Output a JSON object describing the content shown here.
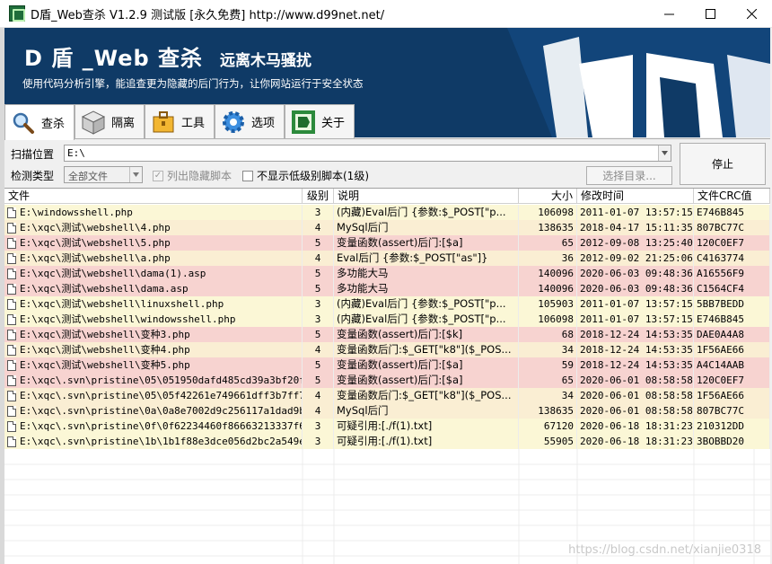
{
  "window": {
    "title": "D盾_Web查杀 V1.2.9 测试版 [永久免费] http://www.d99net.net/"
  },
  "banner": {
    "title": "D 盾 _Web 查杀",
    "subtitle": "远离木马骚扰",
    "description": "使用代码分析引擎，能追查更为隐藏的后门行为，让你网站运行于安全状态"
  },
  "tabs": [
    {
      "label": "查杀",
      "icon": "magnifier-icon",
      "active": true
    },
    {
      "label": "隔离",
      "icon": "box-icon",
      "active": false
    },
    {
      "label": "工具",
      "icon": "toolbox-icon",
      "active": false
    },
    {
      "label": "选项",
      "icon": "gear-icon",
      "active": false
    },
    {
      "label": "关于",
      "icon": "d-logo-icon",
      "active": false
    }
  ],
  "form": {
    "scan_label": "扫描位置",
    "scan_path": "E:\\",
    "type_label": "检测类型",
    "type_value": "全部文件",
    "chk_hidden": "列出隐藏脚本",
    "chk_low": "不显示低级别脚本(1级)",
    "select_dir": "选择目录...",
    "stop": "停止"
  },
  "table": {
    "headers": {
      "file": "文件",
      "level": "级别",
      "desc": "说明",
      "size": "大小",
      "time": "修改时间",
      "crc": "文件CRC值"
    },
    "rows": [
      {
        "file": "E:\\windowsshell.php",
        "level": "3",
        "desc": "(内藏)Eval后门 {参数:$_POST[\"p...",
        "size": "106098",
        "time": "2011-01-07 13:57:15",
        "crc": "E746B845",
        "color": "yellow"
      },
      {
        "file": "E:\\xqc\\测试\\webshell\\4.php",
        "level": "4",
        "desc": "MySql后门",
        "size": "138635",
        "time": "2018-04-17 15:11:35",
        "crc": "807BC77C",
        "color": "tan"
      },
      {
        "file": "E:\\xqc\\测试\\webshell\\5.php",
        "level": "5",
        "desc": "变量函数(assert)后门:[$a]",
        "size": "65",
        "time": "2012-09-08 13:25:40",
        "crc": "120C0EF7",
        "color": "red"
      },
      {
        "file": "E:\\xqc\\测试\\webshell\\a.php",
        "level": "4",
        "desc": "Eval后门 {参数:$_POST[\"as\"]}",
        "size": "36",
        "time": "2012-09-02 21:25:06",
        "crc": "C4163774",
        "color": "tan"
      },
      {
        "file": "E:\\xqc\\测试\\webshell\\dama(1).asp",
        "level": "5",
        "desc": "多功能大马",
        "size": "140096",
        "time": "2020-06-03 09:48:36",
        "crc": "A16556F9",
        "color": "red"
      },
      {
        "file": "E:\\xqc\\测试\\webshell\\dama.asp",
        "level": "5",
        "desc": "多功能大马",
        "size": "140096",
        "time": "2020-06-03 09:48:36",
        "crc": "C1564CF4",
        "color": "red"
      },
      {
        "file": "E:\\xqc\\测试\\webshell\\linuxshell.php",
        "level": "3",
        "desc": "(内藏)Eval后门 {参数:$_POST[\"p...",
        "size": "105903",
        "time": "2011-01-07 13:57:15",
        "crc": "5BB7BEDD",
        "color": "yellow"
      },
      {
        "file": "E:\\xqc\\测试\\webshell\\windowsshell.php",
        "level": "3",
        "desc": "(内藏)Eval后门 {参数:$_POST[\"p...",
        "size": "106098",
        "time": "2011-01-07 13:57:15",
        "crc": "E746B845",
        "color": "yellow"
      },
      {
        "file": "E:\\xqc\\测试\\webshell\\变种3.php",
        "level": "5",
        "desc": "变量函数(assert)后门:[$k]",
        "size": "68",
        "time": "2018-12-24 14:53:35",
        "crc": "DAE0A4A8",
        "color": "red"
      },
      {
        "file": "E:\\xqc\\测试\\webshell\\变种4.php",
        "level": "4",
        "desc": "变量函数后门:$_GET[\"k8\"]($_POS...",
        "size": "34",
        "time": "2018-12-24 14:53:35",
        "crc": "1F56AE66",
        "color": "tan"
      },
      {
        "file": "E:\\xqc\\测试\\webshell\\变种5.php",
        "level": "5",
        "desc": "变量函数(assert)后门:[$a]",
        "size": "59",
        "time": "2018-12-24 14:53:35",
        "crc": "A4C14AAB",
        "color": "red"
      },
      {
        "file": "E:\\xqc\\.svn\\pristine\\05\\051950dafd485cd39a3bf20f...",
        "level": "5",
        "desc": "变量函数(assert)后门:[$a]",
        "size": "65",
        "time": "2020-06-01 08:58:58",
        "crc": "120C0EF7",
        "color": "red"
      },
      {
        "file": "E:\\xqc\\.svn\\pristine\\05\\05f42261e749661dff3b7ff7...",
        "level": "4",
        "desc": "变量函数后门:$_GET[\"k8\"]($_POS...",
        "size": "34",
        "time": "2020-06-01 08:58:58",
        "crc": "1F56AE66",
        "color": "tan"
      },
      {
        "file": "E:\\xqc\\.svn\\pristine\\0a\\0a8e7002d9c256117a1dad9b...",
        "level": "4",
        "desc": "MySql后门",
        "size": "138635",
        "time": "2020-06-01 08:58:58",
        "crc": "807BC77C",
        "color": "tan"
      },
      {
        "file": "E:\\xqc\\.svn\\pristine\\0f\\0f62234460f86663213337f6...",
        "level": "3",
        "desc": "可疑引用:[./f(1).txt]",
        "size": "67120",
        "time": "2020-06-18 18:31:23",
        "crc": "210312DD",
        "color": "yellow"
      },
      {
        "file": "E:\\xqc\\.svn\\pristine\\1b\\1b1f88e3dce056d2bc2a549e...",
        "level": "3",
        "desc": "可疑引用:[./f(1).txt]",
        "size": "55905",
        "time": "2020-06-18 18:31:23",
        "crc": "3BOBBD20",
        "color": "yellow"
      }
    ]
  },
  "watermark": "https://blog.csdn.net/xianjie0318",
  "colors": {
    "banner": "#0f3a66",
    "row_yellow": "#fbf7d6",
    "row_red": "#f7d3d0",
    "row_tan": "#faeed3"
  }
}
